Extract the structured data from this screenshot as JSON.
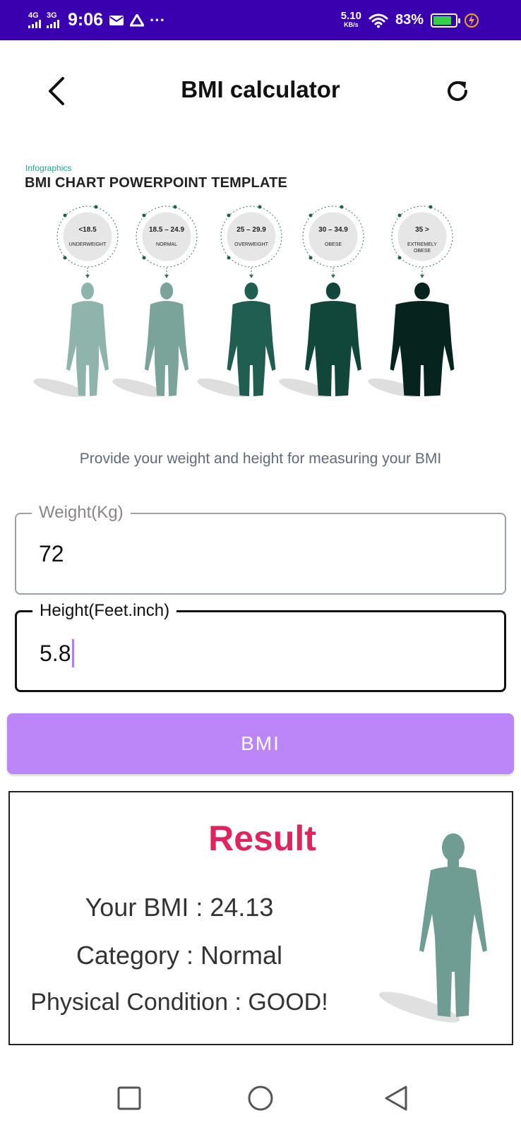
{
  "status_bar": {
    "net1": "4G",
    "net2": "3G",
    "time": "9:06",
    "speed_value": "5.10",
    "speed_unit": "KB/s",
    "battery_pct": "83%",
    "battery_level": 0.83,
    "bg_color": "#3a00b0"
  },
  "header": {
    "title": "BMI calculator",
    "back_icon": "chevron-left-icon",
    "refresh_icon": "refresh-icon"
  },
  "infographic": {
    "subtitle": "Infographics",
    "title": "BMI CHART POWERPOINT TEMPLATE",
    "categories": [
      {
        "range": "<18.5",
        "label1": "UNDERWEIGHT",
        "label2": "",
        "color": "#8fb4ab"
      },
      {
        "range": "18.5 – 24.9",
        "label1": "NORMAL",
        "label2": "",
        "color": "#7aa39a"
      },
      {
        "range": "25 – 29.9",
        "label1": "OVERWEIGHT",
        "label2": "",
        "color": "#1f5e50"
      },
      {
        "range": "30 – 34.9",
        "label1": "OBESE",
        "label2": "",
        "color": "#11463b"
      },
      {
        "range": "35 >",
        "label1": "EXTREMELY",
        "label2": "OBESE",
        "color": "#06231d"
      }
    ]
  },
  "hint": "Provide your weight and height for measuring your BMI",
  "form": {
    "weight_label": "Weight(Kg)",
    "weight_value": "72",
    "height_label": "Height(Feet.inch)",
    "height_value": "5.8"
  },
  "button": {
    "label": "BMI",
    "color": "#bc86f9"
  },
  "result": {
    "title": "Result",
    "bmi_line": "Your BMI : 24.13",
    "category_line": "Category : Normal",
    "condition_line": "Physical Condition : GOOD!",
    "title_color": "#e0245e"
  },
  "nav": {
    "recents_icon": "square-icon",
    "home_icon": "circle-icon",
    "back_icon": "triangle-back-icon"
  }
}
